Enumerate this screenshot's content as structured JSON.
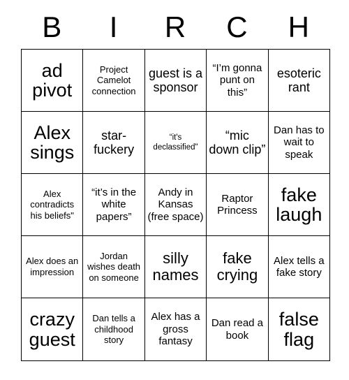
{
  "card": {
    "title_letters": [
      "B",
      "I",
      "R",
      "C",
      "H"
    ],
    "rows": [
      [
        {
          "text": "ad pivot",
          "size": "fs-xxl"
        },
        {
          "text": "Project Camelot connection",
          "size": "fs-s"
        },
        {
          "text": "guest is a sponsor",
          "size": "fs-l"
        },
        {
          "text": "“I’m gonna punt on this”",
          "size": "fs-m"
        },
        {
          "text": "esoteric rant",
          "size": "fs-l"
        }
      ],
      [
        {
          "text": "Alex sings",
          "size": "fs-xxl"
        },
        {
          "text": "star-fuckery",
          "size": "fs-l"
        },
        {
          "text": "“it's declassified\"",
          "size": "fs-xs"
        },
        {
          "text": "“mic down clip”",
          "size": "fs-l"
        },
        {
          "text": "Dan has to wait to speak",
          "size": "fs-m"
        }
      ],
      [
        {
          "text": "Alex contradicts his beliefs\"",
          "size": "fs-s"
        },
        {
          "text": "“it’s in the white papers”",
          "size": "fs-m"
        },
        {
          "text": "Andy in Kansas (free space)",
          "size": "fs-m"
        },
        {
          "text": "Raptor Princess",
          "size": "fs-m"
        },
        {
          "text": "fake laugh",
          "size": "fs-xxl"
        }
      ],
      [
        {
          "text": "Alex does an impression",
          "size": "fs-s"
        },
        {
          "text": "Jordan wishes death on someone",
          "size": "fs-s"
        },
        {
          "text": "silly names",
          "size": "fs-xl"
        },
        {
          "text": "fake crying",
          "size": "fs-xl"
        },
        {
          "text": "Alex tells a fake story",
          "size": "fs-m"
        }
      ],
      [
        {
          "text": "crazy guest",
          "size": "fs-xxl"
        },
        {
          "text": "Dan tells a childhood story",
          "size": "fs-s"
        },
        {
          "text": "Alex has a gross fantasy",
          "size": "fs-m"
        },
        {
          "text": "Dan read a book",
          "size": "fs-m"
        },
        {
          "text": "false flag",
          "size": "fs-xxl"
        }
      ]
    ]
  },
  "colors": {
    "background": "#ffffff",
    "text": "#000000",
    "border": "#000000"
  }
}
